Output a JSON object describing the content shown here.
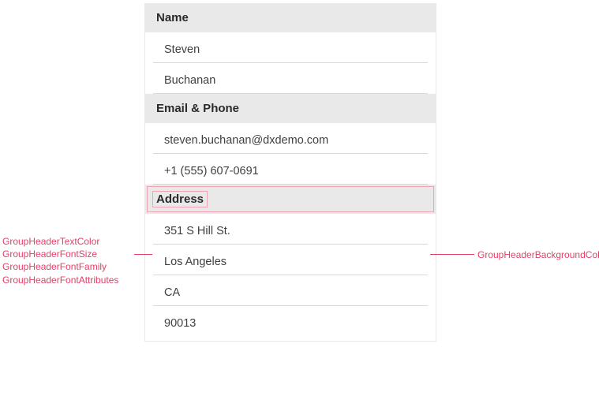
{
  "groups": {
    "name": {
      "header": "Name",
      "rows": [
        "Steven",
        "Buchanan"
      ]
    },
    "contact": {
      "header": "Email & Phone",
      "rows": [
        "steven.buchanan@dxdemo.com",
        "+1 (555) 607-0691"
      ]
    },
    "address": {
      "header": "Address",
      "rows": [
        "351 S Hill St.",
        "Los Angeles",
        "CA",
        "90013"
      ]
    }
  },
  "callouts": {
    "left": [
      "GroupHeaderTextColor",
      "GroupHeaderFontSize",
      "GroupHeaderFontFamily",
      "GroupHeaderFontAttributes"
    ],
    "right": "GroupHeaderBackgroundColor"
  }
}
